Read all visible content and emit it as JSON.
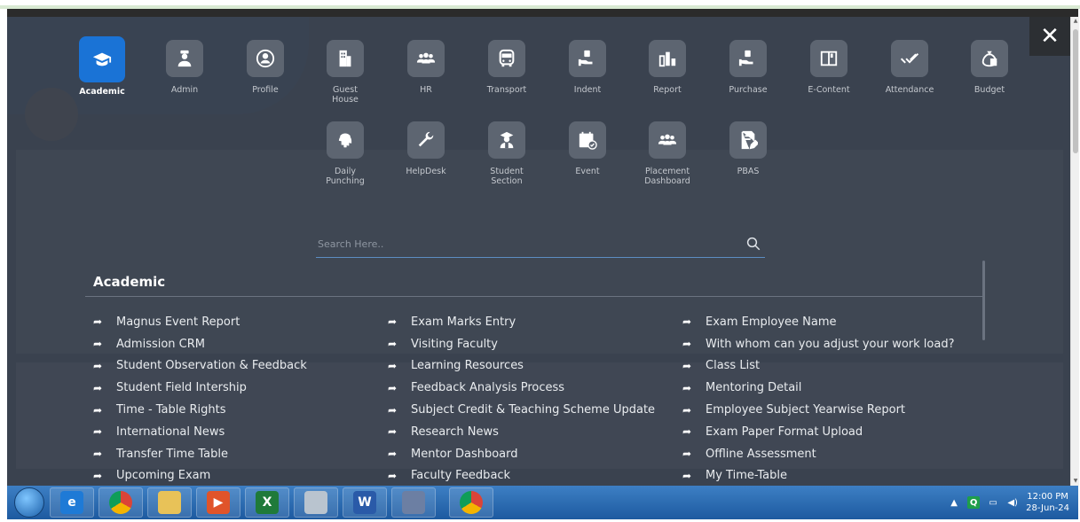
{
  "modules_row1": [
    {
      "label": "Academic",
      "icon": "graduation-cap-icon",
      "active": true
    },
    {
      "label": "Admin",
      "icon": "admin-user-icon"
    },
    {
      "label": "Profile",
      "icon": "profile-icon"
    },
    {
      "label": "Guest House",
      "icon": "building-icon"
    },
    {
      "label": "HR",
      "icon": "people-group-icon"
    },
    {
      "label": "Transport",
      "icon": "bus-icon"
    },
    {
      "label": "Indent",
      "icon": "hand-box-icon"
    },
    {
      "label": "Report",
      "icon": "bar-chart-icon"
    },
    {
      "label": "Purchase",
      "icon": "hand-box-icon"
    },
    {
      "label": "E-Content",
      "icon": "book-icon"
    },
    {
      "label": "Attendance",
      "icon": "double-check-icon"
    },
    {
      "label": "Budget",
      "icon": "money-bag-icon"
    }
  ],
  "modules_row2": [
    {
      "label": "Daily Punching",
      "icon": "fingerprint-icon"
    },
    {
      "label": "HelpDesk",
      "icon": "wrench-icon"
    },
    {
      "label": "Student Section",
      "icon": "student-icon"
    },
    {
      "label": "Event",
      "icon": "calendar-check-icon"
    },
    {
      "label": "Placement Dashboard",
      "icon": "people-group-icon"
    },
    {
      "label": "PBAS",
      "icon": "edit-document-icon"
    }
  ],
  "search": {
    "placeholder": "Search Here.."
  },
  "section": {
    "title": "Academic"
  },
  "links": {
    "col1": [
      "Magnus Event Report",
      "Admission CRM",
      "Student Observation & Feedback",
      "Student Field Intership",
      "Time - Table Rights",
      "International News",
      "Transfer Time Table",
      "Upcoming Exam"
    ],
    "col2": [
      "Exam Marks Entry",
      "Visiting Faculty",
      "Learning Resources",
      "Feedback Analysis Process",
      "Subject Credit & Teaching Scheme Update",
      "Research News",
      "Mentor Dashboard",
      "Faculty Feedback"
    ],
    "col3": [
      "Exam Employee Name",
      "With whom can you adjust your work load?",
      "Class List",
      "Mentoring Detail",
      "Employee Subject Yearwise Report",
      "Exam Paper Format Upload",
      "Offline Assessment",
      "My Time-Table"
    ]
  },
  "close": {
    "label": "✕"
  },
  "taskbar": {
    "apps": [
      "internet-explorer-icon",
      "chrome-icon",
      "file-explorer-icon",
      "media-player-icon",
      "excel-icon",
      "calculator-icon",
      "word-icon",
      "paint-icon",
      "chrome-profile-icon"
    ],
    "time": "12:00 PM",
    "date": "28-Jun-24"
  },
  "colors": {
    "accent": "#1a73d6",
    "overlay": "#3a4452",
    "tile": "#5d6571"
  }
}
